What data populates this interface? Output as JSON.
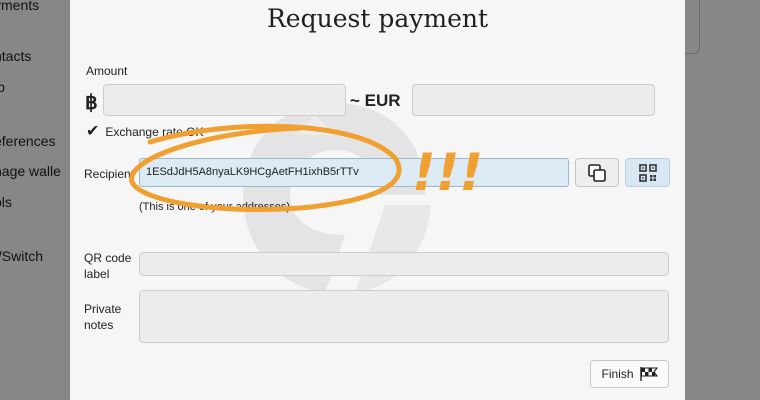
{
  "background": {
    "nav_items": [
      "yments",
      "ntacts",
      "lp",
      "eferences",
      "nage walle",
      "ols",
      "t/Switch"
    ]
  },
  "dialog": {
    "title": "Request payment",
    "amount_label": "Amount",
    "btc_symbol": "฿",
    "btc_amount_value": "",
    "eur_label": "~ EUR",
    "eur_amount_value": "",
    "exchange_status": "Exchange rate OK",
    "recipient_label": "Recipient",
    "recipient_address": "1ESdJdH5A8nyaLK9HCgAetFH1ixhB5rTTv",
    "recipient_hint": "(This is one of your addresses)",
    "qr_label_label": "QR code label",
    "qr_label_value": "",
    "notes_label": "Private notes",
    "notes_value": "",
    "finish_label": "Finish"
  },
  "annotation": {
    "text": "!!!",
    "color": "#f0a030"
  },
  "icons": [
    "check-icon",
    "copy-icon",
    "qr-code-icon",
    "checkered-flag-icon",
    "bitcoin-logo-watermark"
  ]
}
